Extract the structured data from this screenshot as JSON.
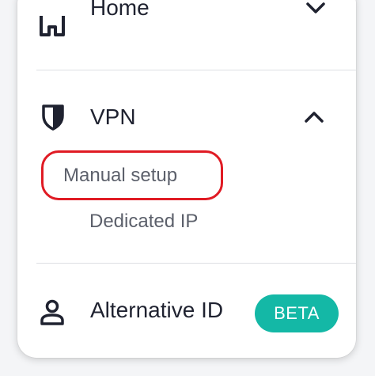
{
  "nav": {
    "home": {
      "label": "Home",
      "icon": "home-icon",
      "chevron": "chevron-down-icon"
    },
    "vpn": {
      "label": "VPN",
      "icon": "shield-icon",
      "chevron": "chevron-up-icon",
      "subitems": [
        {
          "label": "Manual setup",
          "highlighted": true
        },
        {
          "label": "Dedicated IP",
          "highlighted": false
        }
      ]
    },
    "alternative_id": {
      "label": "Alternative ID",
      "icon": "user-icon",
      "badge": "BETA"
    }
  },
  "colors": {
    "text": "#1f2230",
    "subtext": "#5c606b",
    "divider": "#dedfe3",
    "badge": "#14b8a6",
    "highlight": "#e01b24"
  }
}
